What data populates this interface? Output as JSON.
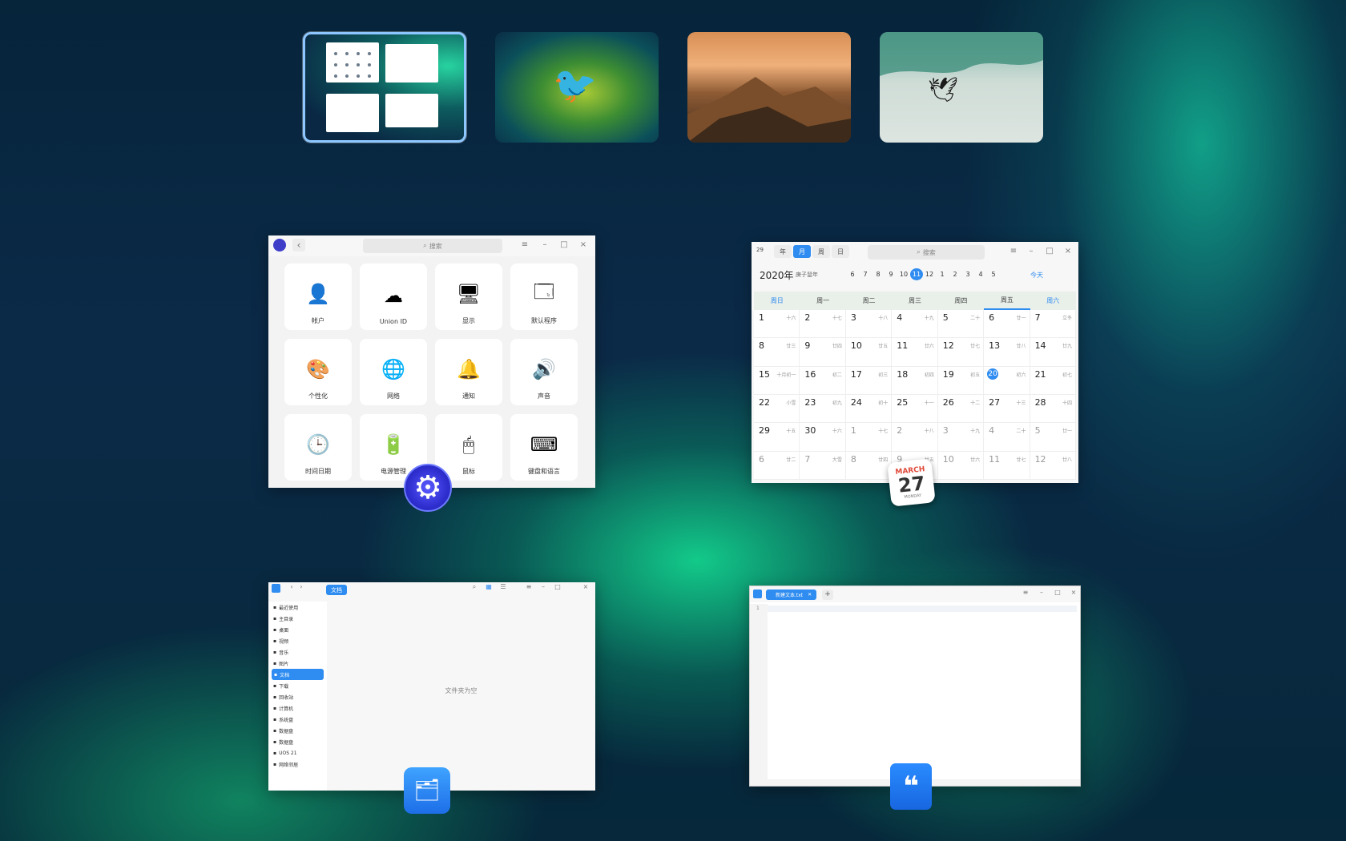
{
  "workspaces": {
    "items": [
      {
        "name": "workspace-1",
        "active": true
      },
      {
        "name": "workspace-2",
        "active": false
      },
      {
        "name": "workspace-3",
        "active": false
      },
      {
        "name": "workspace-4",
        "active": false
      }
    ]
  },
  "settings": {
    "search_placeholder": "搜索",
    "back_glyph": "‹",
    "tiles": [
      {
        "label": "帐户",
        "icon": "account-icon"
      },
      {
        "label": "Union ID",
        "icon": "cloud-icon"
      },
      {
        "label": "显示",
        "icon": "display-icon"
      },
      {
        "label": "默认程序",
        "icon": "default-apps-icon"
      },
      {
        "label": "个性化",
        "icon": "palette-icon"
      },
      {
        "label": "网络",
        "icon": "network-icon"
      },
      {
        "label": "通知",
        "icon": "bell-icon"
      },
      {
        "label": "声音",
        "icon": "speaker-icon"
      },
      {
        "label": "时间日期",
        "icon": "clock-icon"
      },
      {
        "label": "电源管理",
        "icon": "battery-icon"
      },
      {
        "label": "鼠标",
        "icon": "mouse-icon"
      },
      {
        "label": "键盘和语言",
        "icon": "keyboard-icon"
      }
    ]
  },
  "calendar": {
    "app_badge": "29",
    "tabs": [
      "年",
      "月",
      "周",
      "日"
    ],
    "selected_tab": "月",
    "search_placeholder": "搜索",
    "year": "2020年",
    "year_sub": "庚子鼠年",
    "months": [
      "6",
      "7",
      "8",
      "9",
      "10",
      "11",
      "12",
      "1",
      "2",
      "3",
      "4",
      "5"
    ],
    "current_month": "11",
    "today_label": "今天",
    "weekdays": [
      "周日",
      "周一",
      "周二",
      "周三",
      "周四",
      "周五",
      "周六"
    ],
    "weeks": [
      [
        {
          "d": "1",
          "l": "十六"
        },
        {
          "d": "2",
          "l": "十七"
        },
        {
          "d": "3",
          "l": "十八"
        },
        {
          "d": "4",
          "l": "十九"
        },
        {
          "d": "5",
          "l": "二十"
        },
        {
          "d": "6",
          "l": "廿一"
        },
        {
          "d": "7",
          "l": "立冬"
        }
      ],
      [
        {
          "d": "8",
          "l": "廿三"
        },
        {
          "d": "9",
          "l": "廿四"
        },
        {
          "d": "10",
          "l": "廿五"
        },
        {
          "d": "11",
          "l": "廿六"
        },
        {
          "d": "12",
          "l": "廿七"
        },
        {
          "d": "13",
          "l": "廿八"
        },
        {
          "d": "14",
          "l": "廿九"
        }
      ],
      [
        {
          "d": "15",
          "l": "十月初一"
        },
        {
          "d": "16",
          "l": "初二"
        },
        {
          "d": "17",
          "l": "初三"
        },
        {
          "d": "18",
          "l": "初四"
        },
        {
          "d": "19",
          "l": "初五"
        },
        {
          "d": "20",
          "l": "初六"
        },
        {
          "d": "21",
          "l": "初七"
        }
      ],
      [
        {
          "d": "22",
          "l": "小雪"
        },
        {
          "d": "23",
          "l": "初九"
        },
        {
          "d": "24",
          "l": "初十"
        },
        {
          "d": "25",
          "l": "十一"
        },
        {
          "d": "26",
          "l": "十二"
        },
        {
          "d": "27",
          "l": "十三"
        },
        {
          "d": "28",
          "l": "十四"
        }
      ],
      [
        {
          "d": "29",
          "l": "十五"
        },
        {
          "d": "30",
          "l": "十六"
        },
        {
          "d": "1",
          "l": "十七"
        },
        {
          "d": "2",
          "l": "十八"
        },
        {
          "d": "3",
          "l": "十九"
        },
        {
          "d": "4",
          "l": "二十"
        },
        {
          "d": "5",
          "l": "廿一"
        }
      ],
      [
        {
          "d": "6",
          "l": "廿二"
        },
        {
          "d": "7",
          "l": "大雪"
        },
        {
          "d": "8",
          "l": "廿四"
        },
        {
          "d": "9",
          "l": "廿五"
        },
        {
          "d": "10",
          "l": "廿六"
        },
        {
          "d": "11",
          "l": "廿七"
        },
        {
          "d": "12",
          "l": "廿八"
        }
      ]
    ],
    "today_date": "20",
    "icon": {
      "month": "MARCH",
      "day": "27",
      "weekday": "MONDAY"
    }
  },
  "files": {
    "breadcrumb": "文档",
    "sidebar": [
      {
        "label": "最近使用",
        "selected": false
      },
      {
        "label": "主目录",
        "selected": false
      },
      {
        "label": "桌面",
        "selected": false
      },
      {
        "label": "视频",
        "selected": false
      },
      {
        "label": "音乐",
        "selected": false
      },
      {
        "label": "图片",
        "selected": false
      },
      {
        "label": "文档",
        "selected": true
      },
      {
        "label": "下载",
        "selected": false
      },
      {
        "label": "回收站",
        "selected": false
      },
      {
        "label": "计算机",
        "selected": false
      },
      {
        "label": "系统盘",
        "selected": false
      },
      {
        "label": "数据盘",
        "selected": false
      },
      {
        "label": "数据盘",
        "selected": false
      },
      {
        "label": "UOS 21",
        "selected": false
      },
      {
        "label": "网络邻居",
        "selected": false
      }
    ],
    "empty_text": "文件夹为空"
  },
  "editor": {
    "tab_label": "新建文本.txt",
    "add_glyph": "+",
    "line_number": "1"
  }
}
